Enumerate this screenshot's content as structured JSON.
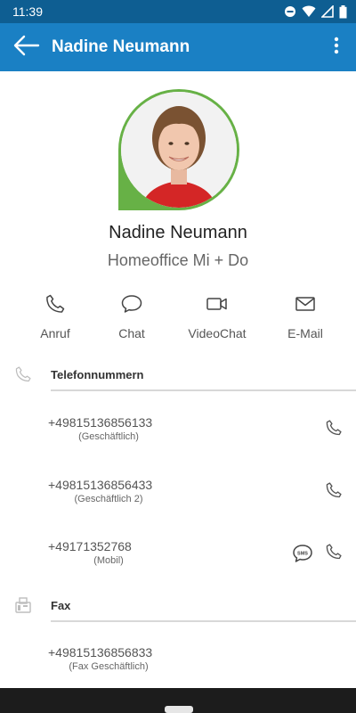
{
  "status_bar": {
    "time": "11:39",
    "icons": [
      "do-not-disturb-icon",
      "wifi-icon",
      "signal-icon",
      "battery-icon"
    ]
  },
  "app_bar": {
    "title": "Nadine Neumann",
    "back_icon": "arrow-left-icon",
    "menu_icon": "more-vert-icon"
  },
  "profile": {
    "name": "Nadine Neumann",
    "status": "Homeoffice Mi + Do",
    "presence_color": "#67b146"
  },
  "actions": [
    {
      "label": "Anruf",
      "icon": "phone-icon"
    },
    {
      "label": "Chat",
      "icon": "chat-icon"
    },
    {
      "label": "VideoChat",
      "icon": "video-icon"
    },
    {
      "label": "E-Mail",
      "icon": "mail-icon"
    }
  ],
  "phone_section": {
    "title": "Telefonnummern",
    "icon": "phone-icon",
    "entries": [
      {
        "number": "+49815136856133",
        "type": "(Geschäftlich)"
      },
      {
        "number": "+49815136856433",
        "type": "(Geschäftlich 2)"
      },
      {
        "number": "+49171352768",
        "type": "(Mobil)",
        "sms_icon": "sms-icon"
      }
    ]
  },
  "fax_section": {
    "title": "Fax",
    "icon": "fax-icon",
    "entries": [
      {
        "number": "+49815136856833",
        "type": "(Fax Geschäftlich)"
      }
    ]
  },
  "colors": {
    "status_bar": "#0e5e92",
    "app_bar": "#1a80c4",
    "presence": "#67b146"
  }
}
